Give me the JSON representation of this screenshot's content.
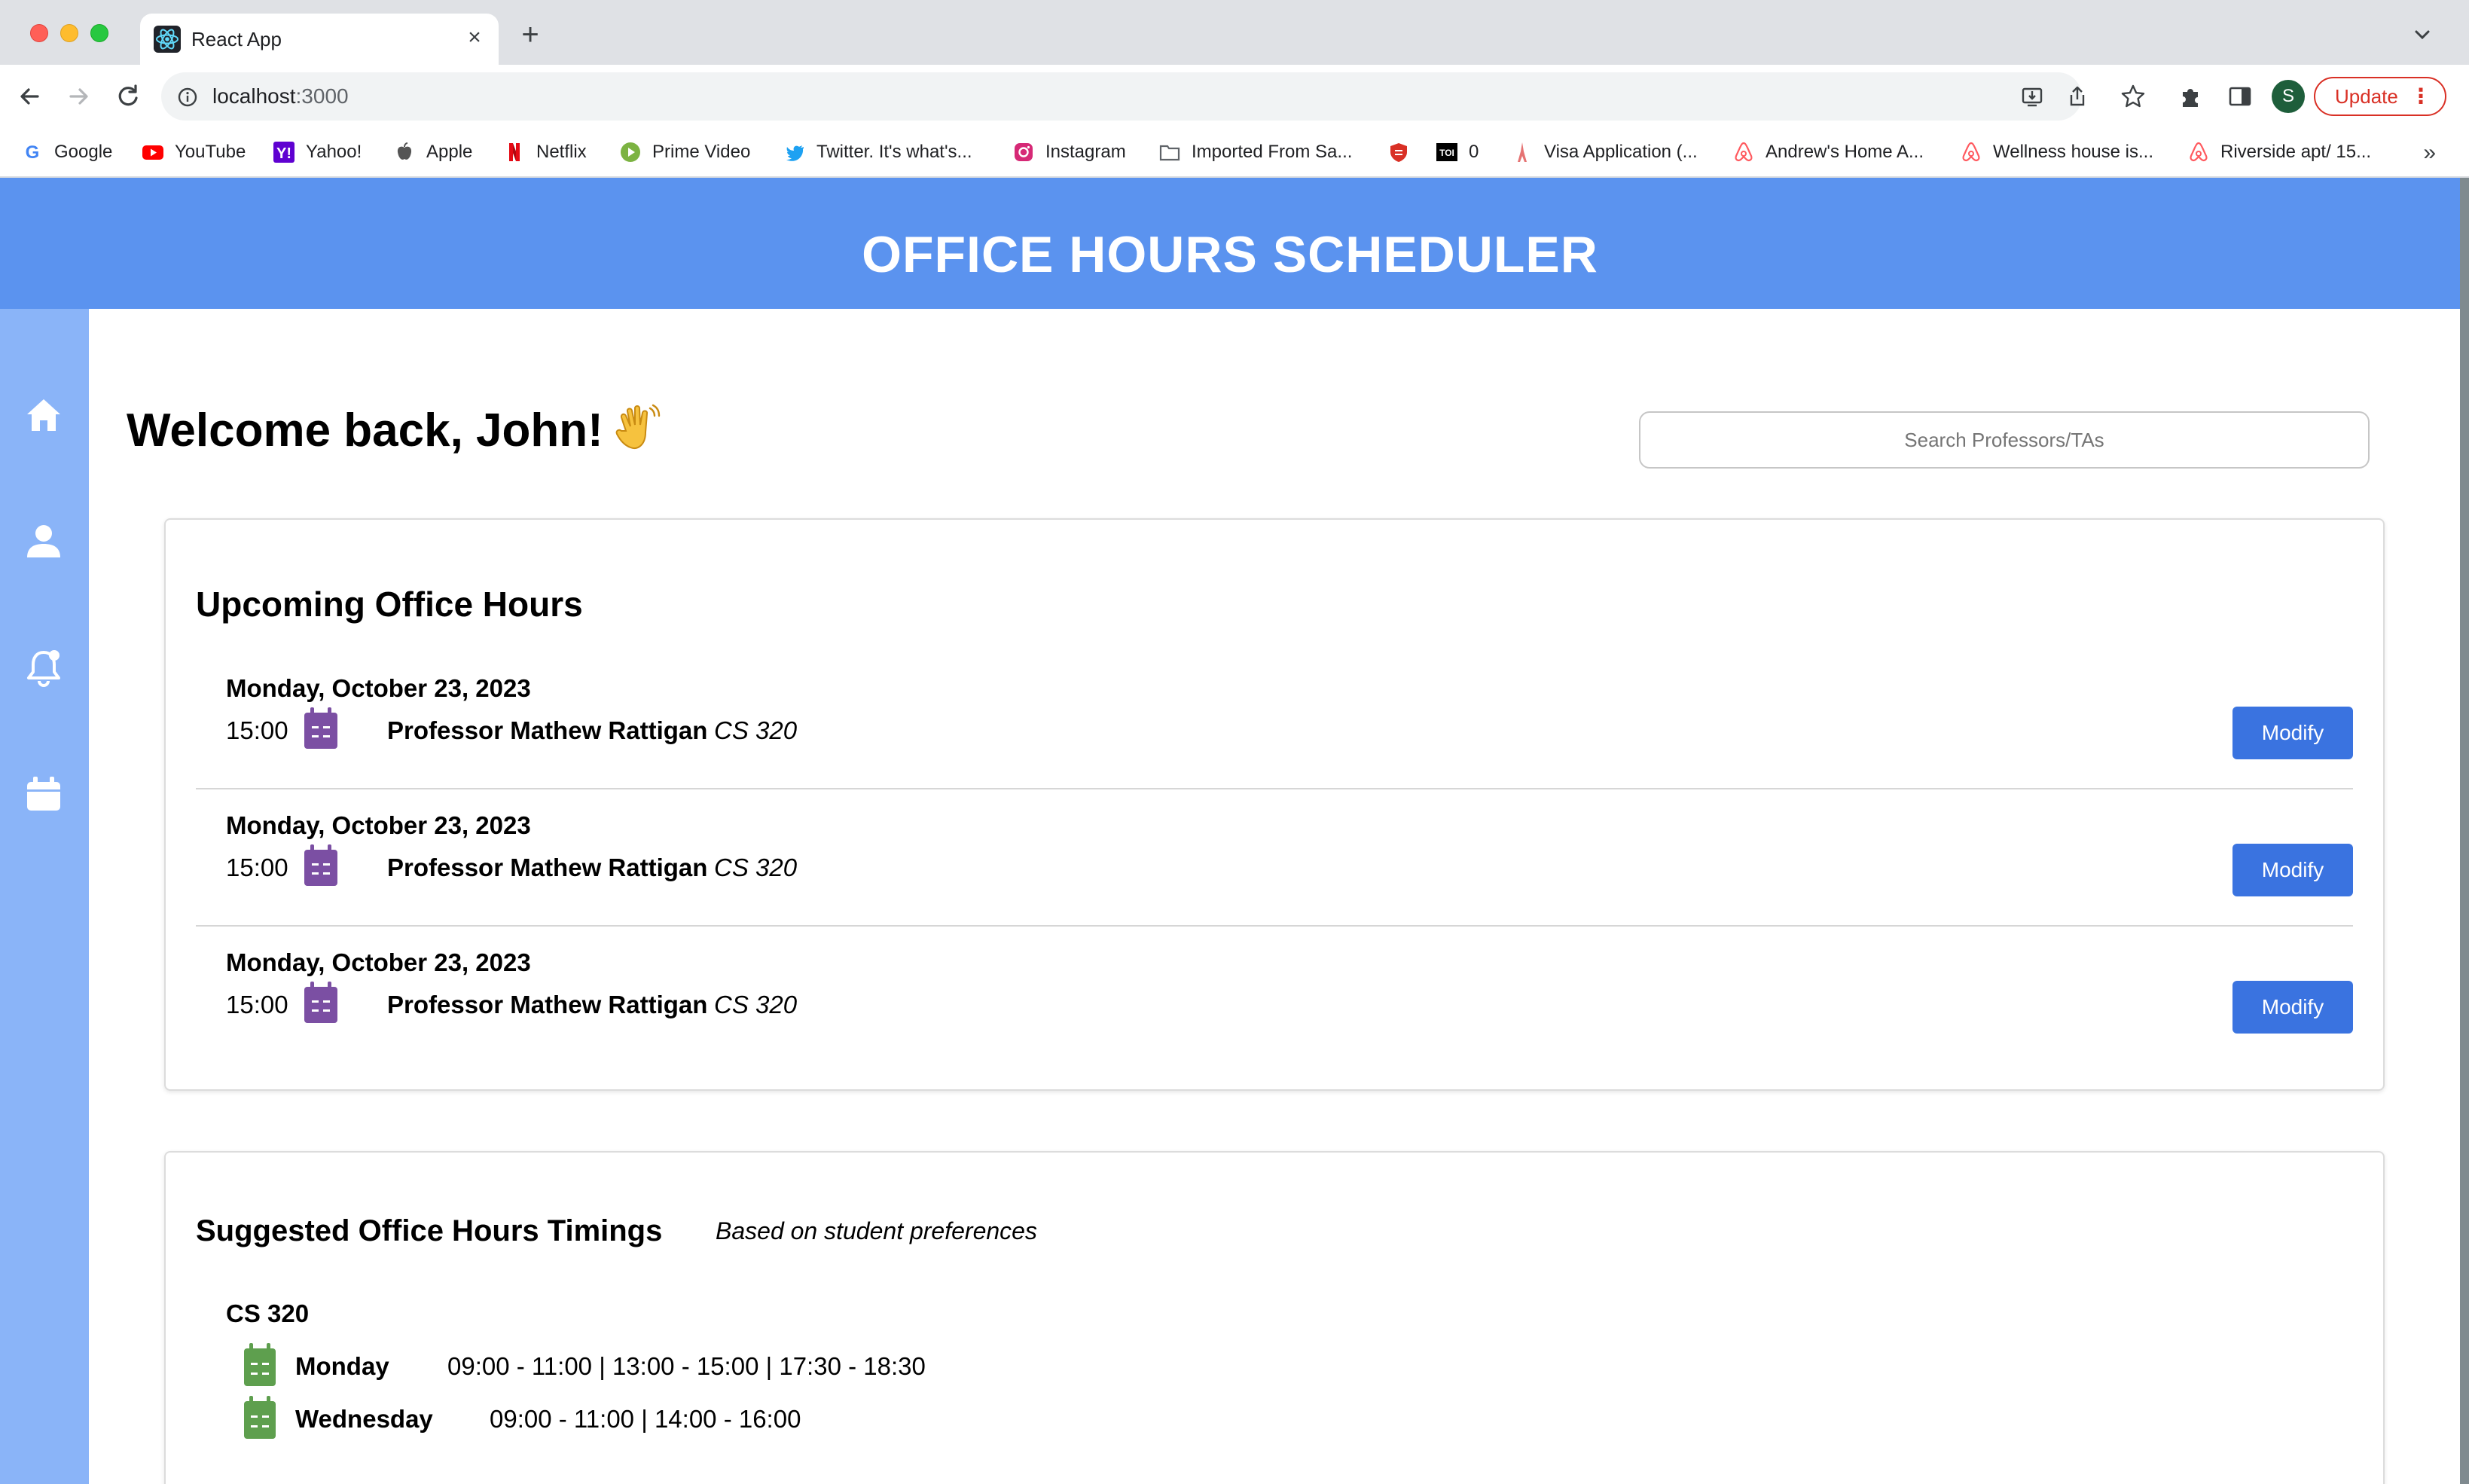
{
  "browser": {
    "tab": {
      "title": "React App",
      "close": "×"
    },
    "new_tab": "+",
    "url": {
      "host": "localhost",
      "port": ":3000"
    },
    "profile_initial": "S",
    "update_label": "Update",
    "update_menu": "⋮",
    "bookmarks_more": "»",
    "bookmarks": [
      {
        "label": "Google",
        "icon": "google-icon",
        "color": "#4285f4"
      },
      {
        "label": "YouTube",
        "icon": "youtube-icon",
        "color": "#ff0000"
      },
      {
        "label": "Yahoo!",
        "icon": "yahoo-icon",
        "color": "#5f01d1"
      },
      {
        "label": "Apple",
        "icon": "apple-icon",
        "color": "#555555"
      },
      {
        "label": "Netflix",
        "icon": "netflix-icon",
        "color": "#e50914"
      },
      {
        "label": "Prime Video",
        "icon": "prime-video-icon",
        "color": "#7cb342"
      },
      {
        "label": "Twitter. It's what's...",
        "icon": "twitter-icon",
        "color": "#1da1f2"
      },
      {
        "label": "Instagram",
        "icon": "instagram-icon",
        "color": "#d62976"
      },
      {
        "label": "Imported From Sa...",
        "icon": "folder-icon",
        "color": "#5f6368"
      },
      {
        "label": "",
        "icon": "shield-icon",
        "color": "#d93025"
      },
      {
        "label": "0",
        "icon": "toi-icon",
        "color": "#000000"
      },
      {
        "label": "Visa Application (...",
        "icon": "eiffel-icon",
        "color": "#e57373"
      },
      {
        "label": "Andrew's Home A...",
        "icon": "airbnb-icon",
        "color": "#ff5a5f"
      },
      {
        "label": "Wellness house is...",
        "icon": "airbnb-icon",
        "color": "#ff5a5f"
      },
      {
        "label": "Riverside apt/ 15...",
        "icon": "airbnb-icon",
        "color": "#ff5a5f"
      }
    ]
  },
  "app": {
    "title": "OFFICE HOURS SCHEDULER",
    "colors": {
      "header": "#5b93ef",
      "sidebar": "#8ab4f8",
      "button": "#3a73e0",
      "upcoming_calendar": "#7b4fa3",
      "suggested_calendar": "#5e9f4e"
    },
    "sidebar": [
      "home-icon",
      "profile-icon",
      "notifications-icon",
      "calendar-icon"
    ],
    "welcome": "Welcome back, John!",
    "search_placeholder": "Search Professors/TAs",
    "upcoming": {
      "title": "Upcoming Office Hours",
      "items": [
        {
          "date": "Monday, October 23, 2023",
          "time": "15:00",
          "professor": "Professor Mathew Rattigan",
          "course": "CS 320",
          "action": "Modify"
        },
        {
          "date": "Monday, October 23, 2023",
          "time": "15:00",
          "professor": "Professor Mathew Rattigan",
          "course": "CS 320",
          "action": "Modify"
        },
        {
          "date": "Monday, October 23, 2023",
          "time": "15:00",
          "professor": "Professor Mathew Rattigan",
          "course": "CS 320",
          "action": "Modify"
        }
      ]
    },
    "suggested": {
      "title": "Suggested Office Hours Timings",
      "note": "Based on student preferences",
      "course": "CS 320",
      "rows": [
        {
          "day": "Monday",
          "times": "09:00 - 11:00 | 13:00 - 15:00 | 17:30 - 18:30"
        },
        {
          "day": "Wednesday",
          "times": "09:00 - 11:00 | 14:00 - 16:00"
        }
      ]
    }
  }
}
